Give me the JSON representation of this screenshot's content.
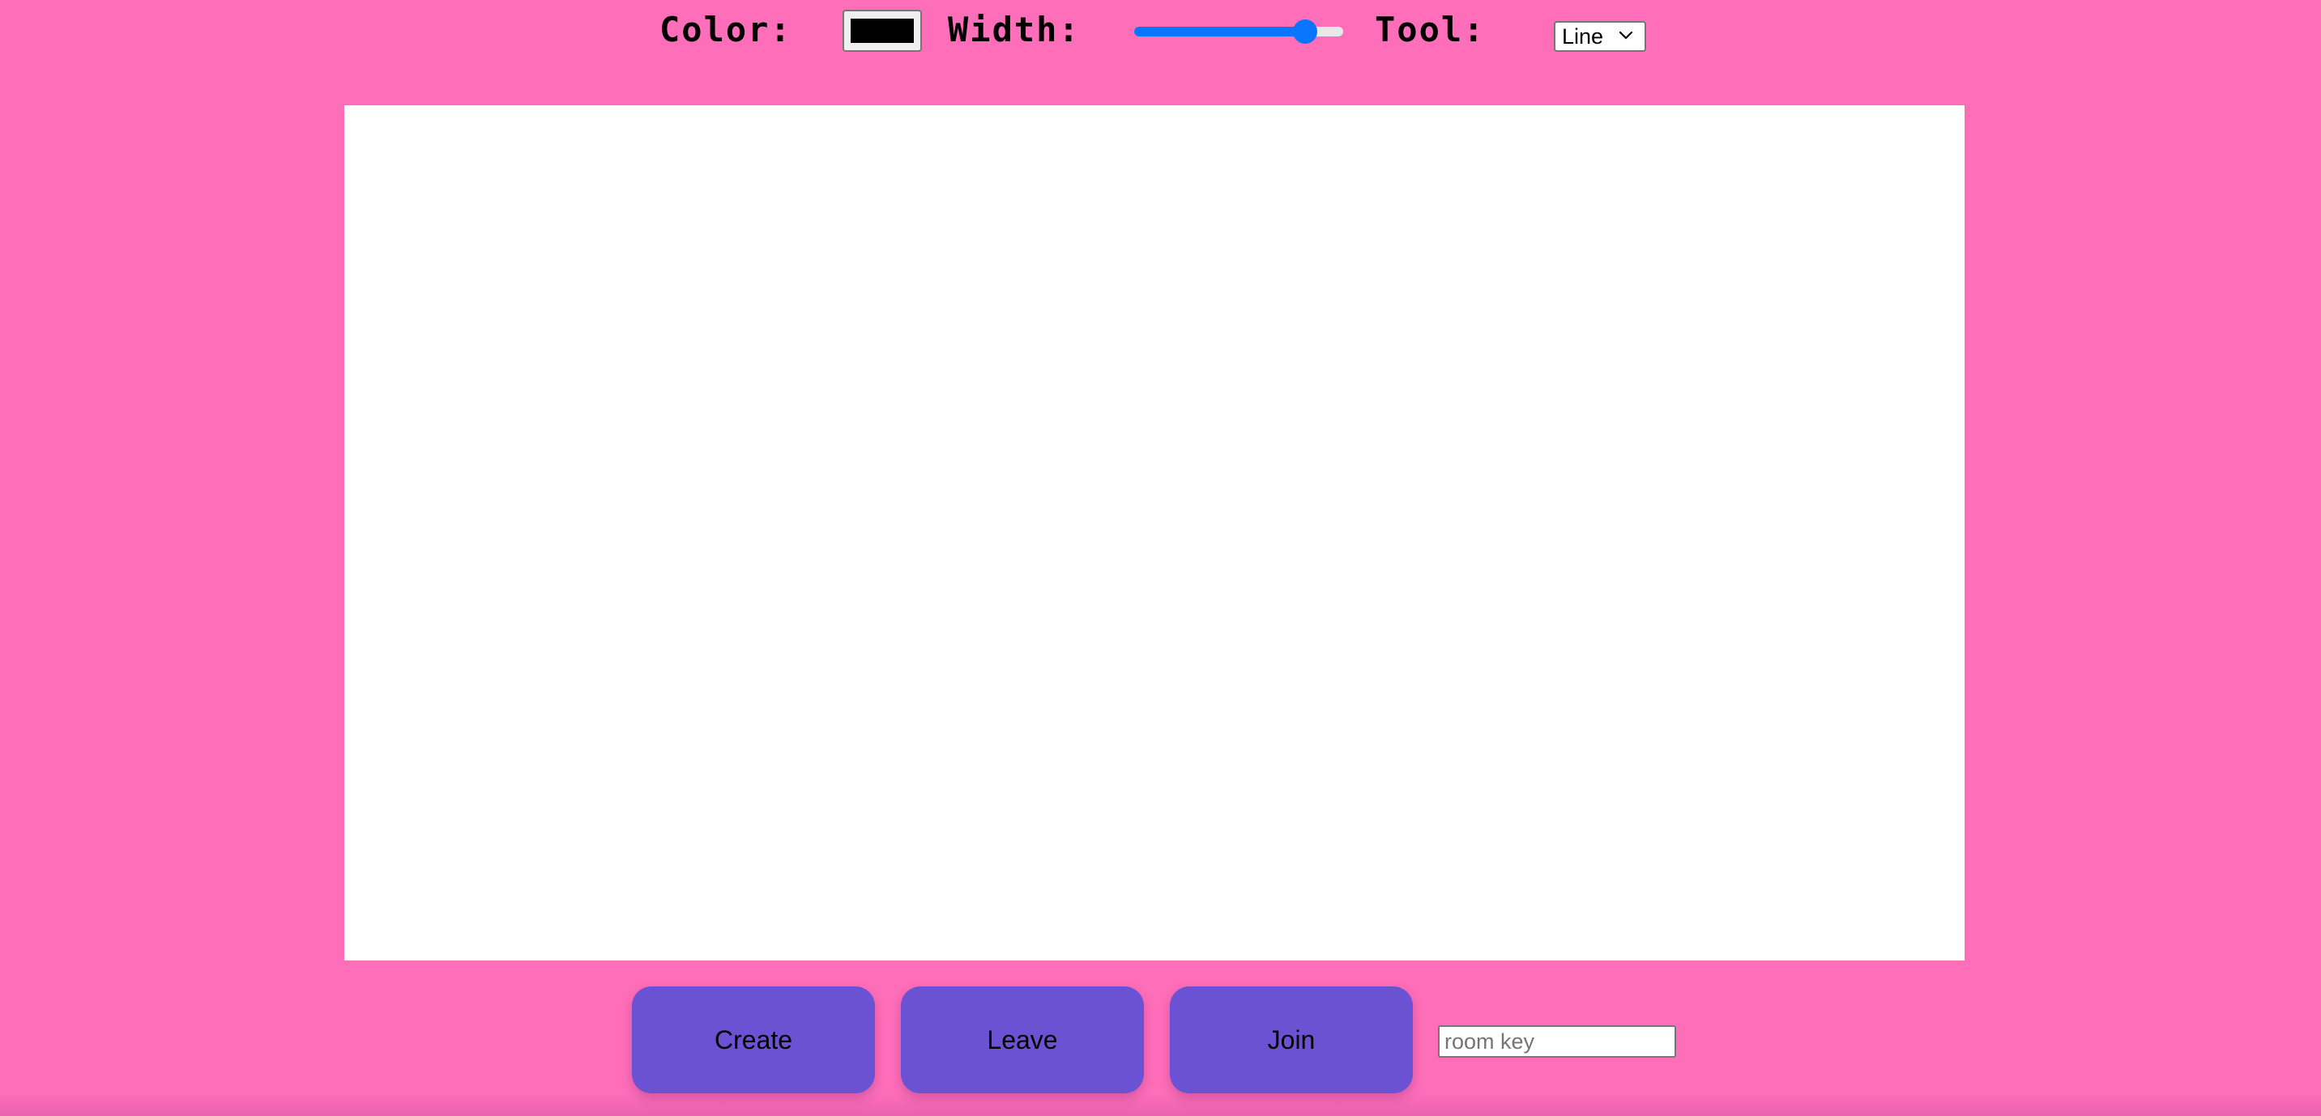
{
  "toolbar": {
    "color_label": "Color:",
    "color_value": "#000000",
    "width_label": "Width:",
    "width_value_fraction": 0.86,
    "tool_label": "Tool:",
    "tool_selected": "Line"
  },
  "actions": {
    "create_label": "Create",
    "leave_label": "Leave",
    "join_label": "Join",
    "room_key_placeholder": "room key",
    "room_key_value": ""
  },
  "colors": {
    "background": "#ff6eb9",
    "canvas": "#ffffff",
    "button": "#6a52d2",
    "slider_accent": "#0a75ff"
  },
  "icons": {
    "tool_dropdown": "chevron-down-icon"
  }
}
